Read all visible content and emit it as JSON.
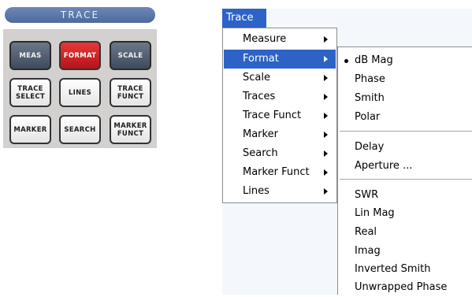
{
  "panel": {
    "title": "TRACE",
    "keys": [
      {
        "label": "MEAS",
        "style": "dark"
      },
      {
        "label": "FORMAT",
        "style": "red"
      },
      {
        "label": "SCALE",
        "style": "dark"
      },
      {
        "label": "TRACE\nSELECT",
        "style": "light"
      },
      {
        "label": "LINES",
        "style": "light"
      },
      {
        "label": "TRACE\nFUNCT",
        "style": "light"
      },
      {
        "label": "MARKER",
        "style": "light"
      },
      {
        "label": "SEARCH",
        "style": "light"
      },
      {
        "label": "MARKER\nFUNCT",
        "style": "light"
      }
    ]
  },
  "menubar": {
    "trace_label": "Trace"
  },
  "menu": {
    "items": [
      {
        "label": "Measure",
        "has_submenu": true
      },
      {
        "label": "Format",
        "has_submenu": true,
        "selected": true
      },
      {
        "label": "Scale",
        "has_submenu": true
      },
      {
        "label": "Traces",
        "has_submenu": true
      },
      {
        "label": "Trace Funct",
        "has_submenu": true
      },
      {
        "label": "Marker",
        "has_submenu": true
      },
      {
        "label": "Search",
        "has_submenu": true
      },
      {
        "label": "Marker Funct",
        "has_submenu": true
      },
      {
        "label": "Lines",
        "has_submenu": true
      }
    ]
  },
  "submenu": {
    "groups": [
      [
        {
          "label": "dB Mag",
          "checked": true
        },
        {
          "label": "Phase"
        },
        {
          "label": "Smith"
        },
        {
          "label": "Polar"
        }
      ],
      [
        {
          "label": "Delay"
        },
        {
          "label": "Aperture ..."
        }
      ],
      [
        {
          "label": "SWR"
        },
        {
          "label": "Lin Mag"
        },
        {
          "label": "Real"
        },
        {
          "label": "Imag"
        },
        {
          "label": "Inverted Smith"
        },
        {
          "label": "Unwrapped Phase"
        }
      ]
    ]
  },
  "colors": {
    "menu_highlight": "#2d63c6",
    "format_key": "#d81e24",
    "panel_header": "#5a76a8"
  }
}
